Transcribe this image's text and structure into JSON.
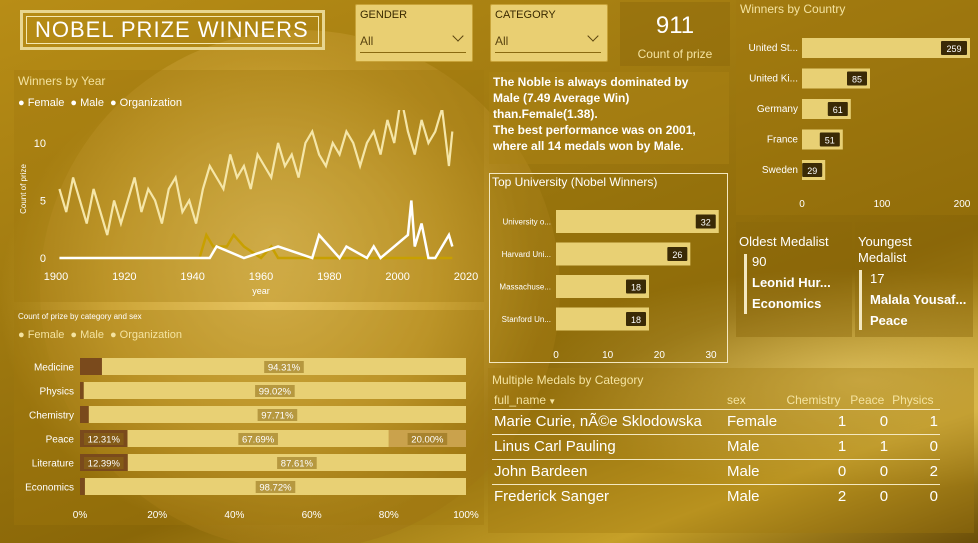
{
  "title": "NOBEL PRIZE WINNERS",
  "filters": {
    "gender": {
      "label": "GENDER",
      "value": "All"
    },
    "category": {
      "label": "CATEGORY",
      "value": "All"
    }
  },
  "card": {
    "value": "911",
    "label": "Count of prize"
  },
  "insight": {
    "line1": "The Noble is always dominated by",
    "line2": "Male (7.49 Average Win)",
    "line3": "than.Female(1.38).",
    "line4": "The best performance was on 2001,",
    "line5": "where all 14 medals won by Male."
  },
  "oldest": {
    "title": "Oldest Medalist",
    "age": "90",
    "name": "Leonid Hur...",
    "category": "Economics"
  },
  "youngest": {
    "title": "Youngest Medalist",
    "age": "17",
    "name": "Malala Yousaf...",
    "category": "Peace"
  },
  "multiple_medals": {
    "title": "Multiple Medals by Category",
    "columns": [
      "full_name",
      "sex",
      "Chemistry",
      "Peace",
      "Physics"
    ],
    "rows": [
      {
        "name": "Marie Curie, nÃ©e Sklodowska",
        "sex": "Female",
        "chem": "1",
        "peace": "0",
        "phys": "1"
      },
      {
        "name": "Linus Carl Pauling",
        "sex": "Male",
        "chem": "1",
        "peace": "1",
        "phys": "0"
      },
      {
        "name": "John Bardeen",
        "sex": "Male",
        "chem": "0",
        "peace": "0",
        "phys": "2"
      },
      {
        "name": "Frederick Sanger",
        "sex": "Male",
        "chem": "2",
        "peace": "0",
        "phys": "0"
      }
    ]
  },
  "colors": {
    "bar": "#e8d074",
    "bar_dark": "#7a4a1c",
    "female": "#ffffff",
    "organization": "#c8a000",
    "text_light": "#f4e3a0"
  },
  "chart_data": [
    {
      "id": "winners_by_year",
      "type": "line",
      "title": "Winners by Year",
      "xlabel": "year",
      "ylabel": "Count of prize",
      "xlim": [
        1900,
        2020
      ],
      "ylim": [
        0,
        12
      ],
      "xticks": [
        1900,
        1920,
        1940,
        1960,
        1980,
        2000,
        2020
      ],
      "yticks": [
        0,
        5,
        10
      ],
      "legend": [
        "Female",
        "Male",
        "Organization"
      ],
      "legend_position": "top-left",
      "series": [
        {
          "name": "Male",
          "color": "#f5e6a8",
          "x": [
            1901,
            1903,
            1905,
            1907,
            1909,
            1911,
            1913,
            1915,
            1917,
            1919,
            1921,
            1923,
            1925,
            1927,
            1929,
            1931,
            1933,
            1935,
            1937,
            1939,
            1941,
            1943,
            1945,
            1947,
            1949,
            1951,
            1953,
            1955,
            1957,
            1959,
            1961,
            1963,
            1965,
            1967,
            1969,
            1971,
            1973,
            1975,
            1977,
            1979,
            1981,
            1983,
            1985,
            1987,
            1989,
            1991,
            1993,
            1995,
            1997,
            1999,
            2001,
            2003,
            2005,
            2007,
            2009,
            2011,
            2013,
            2015,
            2016
          ],
          "y": [
            6,
            4,
            7,
            5,
            3,
            6,
            4,
            2,
            5,
            3,
            5,
            7,
            4,
            6,
            5,
            3,
            6,
            7,
            4,
            5,
            3,
            6,
            8,
            7,
            6,
            9,
            7,
            8,
            6,
            9,
            8,
            7,
            10,
            8,
            9,
            7,
            10,
            11,
            9,
            8,
            10,
            9,
            11,
            10,
            8,
            10,
            11,
            9,
            12,
            10,
            14,
            11,
            9,
            12,
            10,
            11,
            13,
            8,
            11
          ]
        },
        {
          "name": "Female",
          "color": "#ffffff",
          "x": [
            1901,
            1945,
            1947,
            1955,
            1965,
            1975,
            1977,
            1983,
            1985,
            1991,
            1993,
            1995,
            2003,
            2004,
            2005,
            2007,
            2009,
            2011,
            2013,
            2015,
            2016
          ],
          "y": [
            0,
            0,
            1,
            0,
            1,
            0,
            2,
            0,
            1,
            0,
            1,
            0,
            2,
            5,
            1,
            3,
            0,
            0,
            1,
            2,
            1
          ]
        },
        {
          "name": "Organization",
          "color": "#c8a000",
          "x": [
            1901,
            1942,
            1944,
            1946,
            1950,
            1952,
            1955,
            1960,
            1963,
            1965,
            1975,
            2000,
            2016
          ],
          "y": [
            0,
            0,
            2,
            1,
            1,
            2,
            1,
            0,
            1,
            0,
            0,
            0,
            0
          ]
        }
      ]
    },
    {
      "id": "winners_by_country",
      "type": "bar",
      "orientation": "horizontal",
      "title": "Winners by Country",
      "categories": [
        "United St...",
        "United Ki...",
        "Germany",
        "France",
        "Sweden"
      ],
      "values": [
        259,
        85,
        61,
        51,
        29
      ],
      "xlim": [
        0,
        200
      ],
      "xticks": [
        0,
        100,
        200
      ]
    },
    {
      "id": "top_university",
      "type": "bar",
      "orientation": "horizontal",
      "title": "Top University (Nobel Winners)",
      "categories": [
        "University o...",
        "Harvard Uni...",
        "Massachuse...",
        "Stanford Un..."
      ],
      "values": [
        32,
        26,
        18,
        18
      ],
      "xlim": [
        0,
        30
      ],
      "xticks": [
        0,
        10,
        20,
        30
      ]
    },
    {
      "id": "category_sex",
      "type": "bar",
      "orientation": "horizontal",
      "stacked": "100%",
      "title": "Count of prize by category and sex",
      "legend": [
        "Female",
        "Male",
        "Organization"
      ],
      "categories": [
        "Medicine",
        "Physics",
        "Chemistry",
        "Peace",
        "Literature",
        "Economics"
      ],
      "series": [
        {
          "name": "Female",
          "values": [
            5.69,
            0.98,
            2.29,
            12.31,
            12.39,
            1.28
          ],
          "labels": [
            "",
            "",
            "",
            "12.31%",
            "12.39%",
            ""
          ]
        },
        {
          "name": "Male",
          "values": [
            94.31,
            99.02,
            97.71,
            67.69,
            87.61,
            98.72
          ],
          "labels": [
            "94.31%",
            "99.02%",
            "97.71%",
            "67.69%",
            "87.61%",
            "98.72%"
          ]
        },
        {
          "name": "Organization",
          "values": [
            0,
            0,
            0,
            20.0,
            0,
            0
          ],
          "labels": [
            "",
            "",
            "",
            "20.00%",
            "",
            ""
          ]
        }
      ],
      "xticks": [
        "0%",
        "20%",
        "40%",
        "60%",
        "80%",
        "100%"
      ]
    }
  ]
}
